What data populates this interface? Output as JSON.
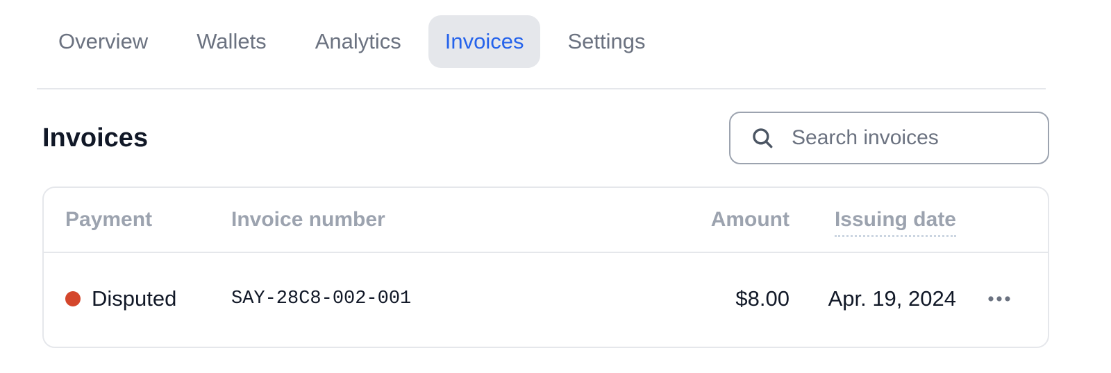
{
  "tabs": [
    {
      "label": "Overview",
      "active": false
    },
    {
      "label": "Wallets",
      "active": false
    },
    {
      "label": "Analytics",
      "active": false
    },
    {
      "label": "Invoices",
      "active": true
    },
    {
      "label": "Settings",
      "active": false
    }
  ],
  "page": {
    "title": "Invoices"
  },
  "search": {
    "placeholder": "Search invoices",
    "value": "",
    "icon": "search-icon"
  },
  "table": {
    "columns": {
      "payment": "Payment",
      "invoice_number": "Invoice number",
      "amount": "Amount",
      "issuing_date": "Issuing date"
    },
    "rows": [
      {
        "payment_status": "Disputed",
        "status_color": "#d4462b",
        "invoice_number": "SAY-28C8-002-001",
        "amount": "$8.00",
        "issuing_date": "Apr. 19, 2024",
        "menu_icon": "more-horizontal-icon"
      }
    ]
  },
  "colors": {
    "accent": "#2563eb",
    "muted_text": "#6b7280",
    "header_text": "#9ca3af",
    "border": "#e5e7eb",
    "active_tab_bg": "#e5e7eb"
  }
}
